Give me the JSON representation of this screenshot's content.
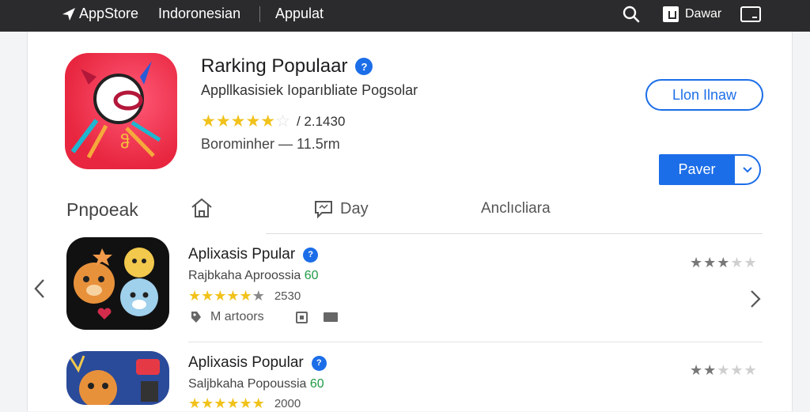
{
  "topbar": {
    "brand": "AppStore",
    "region": "Indoronesian",
    "tab": "Appulat",
    "account_label": "Dawar"
  },
  "hero": {
    "title": "Rarking Populaar",
    "subtitle": "Appllkasisiek Ioparıbliate Pogsolar",
    "rating_count": "/ 2.1430",
    "meta": "Borominher — 11.5rm",
    "secondary_button": "Llon Ilnaw",
    "primary_button": "Paver",
    "stars_value": 4.5
  },
  "section": {
    "title": "Pnpoeak",
    "tabs": {
      "day": "Day",
      "category": "Anclıcliara"
    }
  },
  "apps": [
    {
      "title": "Aplixasis Ppular",
      "subtitle": "Rajbkaha Aproossia",
      "subtitle_num": "60",
      "rating_count": "2530",
      "info": "M artoors",
      "stars_value": 4.5,
      "right_stars_value": 2.5
    },
    {
      "title": "Aplixasis Popular",
      "subtitle": "Saljbkaha Popoussia",
      "subtitle_num": "60",
      "rating_count": "2000",
      "stars_value": 4.5,
      "right_stars_value": 2
    }
  ],
  "colors": {
    "topbar": "#2b2b2d",
    "accent": "#1c6ee8",
    "star": "#f1c21b",
    "hero_icon": "#e8263f",
    "green": "#1f9a46"
  }
}
